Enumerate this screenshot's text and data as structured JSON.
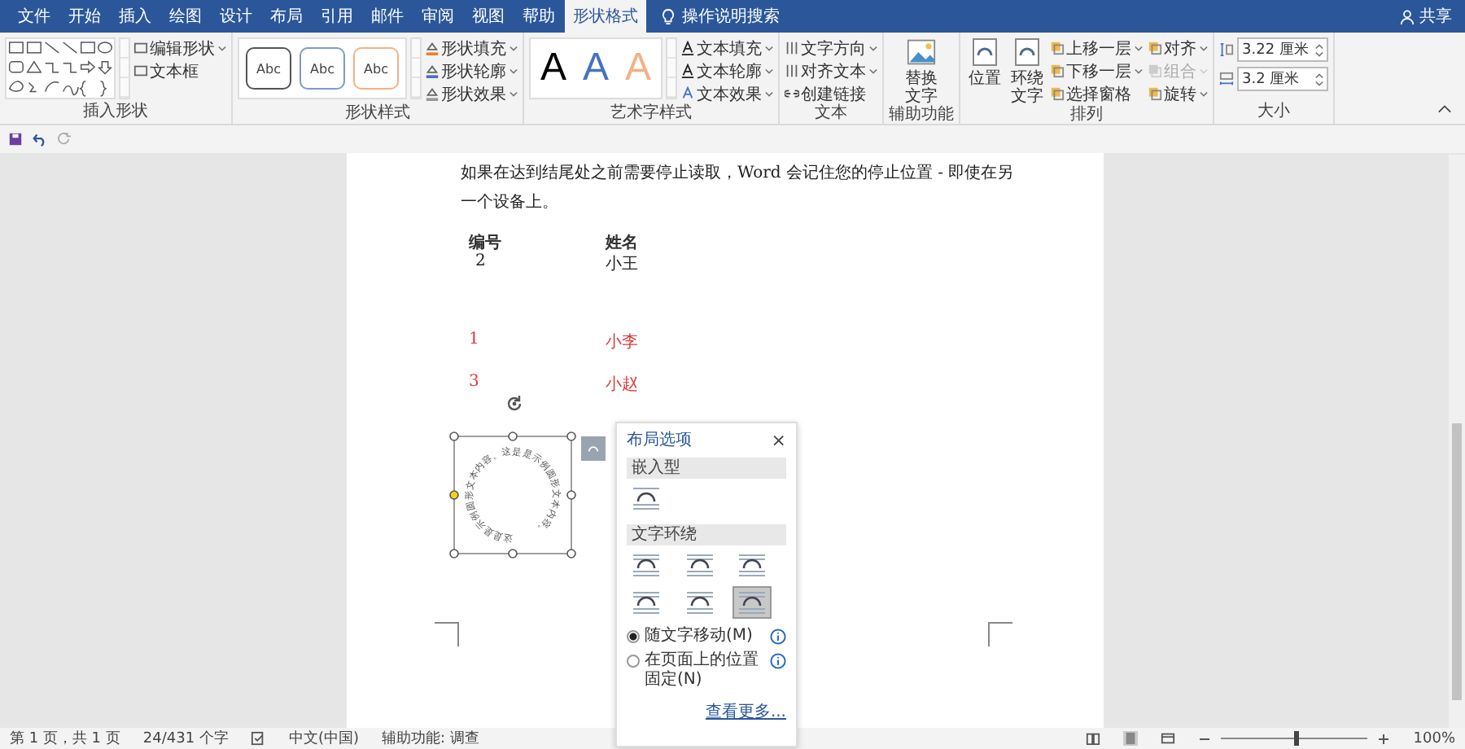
{
  "tabs": [
    {
      "label": "文件",
      "selected": false
    },
    {
      "label": "开始",
      "selected": false
    },
    {
      "label": "插入",
      "selected": false
    },
    {
      "label": "绘图",
      "selected": false
    },
    {
      "label": "设计",
      "selected": false
    },
    {
      "label": "布局",
      "selected": false
    },
    {
      "label": "引用",
      "selected": false
    },
    {
      "label": "邮件",
      "selected": false
    },
    {
      "label": "审阅",
      "selected": false
    },
    {
      "label": "视图",
      "selected": false
    },
    {
      "label": "帮助",
      "selected": false
    },
    {
      "label": "形状格式",
      "selected": true
    }
  ],
  "tell_me": "操作说明搜索",
  "share": "共享",
  "ribbon": {
    "insert_shapes": {
      "label": "插入形状",
      "commands": [
        "编辑形状",
        "文本框"
      ]
    },
    "shape_styles": {
      "label": "形状样式",
      "presets": [
        "Abc",
        "Abc",
        "Abc"
      ],
      "commands": [
        "形状填充",
        "形状轮廓",
        "形状效果"
      ]
    },
    "wordart_styles": {
      "label": "艺术字样式",
      "presets": [
        "A",
        "A",
        "A"
      ],
      "commands": [
        "文本填充",
        "文本轮廓",
        "文本效果"
      ]
    },
    "text": {
      "label": "文本",
      "commands": [
        "文字方向",
        "对齐文本",
        "创建链接"
      ]
    },
    "accessibility": {
      "label": "辅助功能",
      "button": "替换文字"
    },
    "arrange": {
      "label": "排列",
      "big_buttons": [
        "位置",
        "环绕文字"
      ],
      "commands": [
        {
          "label": "上移一层",
          "disabled": false
        },
        {
          "label": "下移一层",
          "disabled": false
        },
        {
          "label": "选择窗格",
          "disabled": false
        },
        {
          "label": "对齐",
          "disabled": false
        },
        {
          "label": "组合",
          "disabled": true
        },
        {
          "label": "旋转",
          "disabled": false
        }
      ]
    },
    "size": {
      "label": "大小",
      "height": "3.22 厘米",
      "width": "3.2 厘米"
    }
  },
  "document": {
    "paragraph": "如果在达到结尾处之前需要停止读取，Word 会记住您的停止位置 - 即使在另一个设备上。",
    "table": {
      "columns": [
        "编号",
        "姓名"
      ],
      "rows": [
        {
          "cells": [
            "2",
            "小王"
          ],
          "color": "#222222"
        },
        {
          "cells": [
            "1",
            "小李"
          ],
          "color": "#d83b3b"
        },
        {
          "cells": [
            "3",
            "小赵"
          ],
          "color": "#d83b3b"
        }
      ]
    },
    "circle_text": "这是是示例圆形文本内容。这是是示例圆形文本内容。"
  },
  "layout_options": {
    "title": "布局选项",
    "close": "×",
    "inline_heading": "嵌入型",
    "wrap_heading": "文字环绕",
    "inline_option": {
      "selected": false
    },
    "wrap_options": [
      {
        "selected": false
      },
      {
        "selected": false
      },
      {
        "selected": false
      },
      {
        "selected": false
      },
      {
        "selected": false
      },
      {
        "selected": true
      }
    ],
    "radios": [
      {
        "label": "随文字移动(M)",
        "selected": true
      },
      {
        "label": "在页面上的位置固定(N)",
        "selected": false
      }
    ],
    "see_more": "查看更多..."
  },
  "status_bar": {
    "page": "第 1 页，共 1 页",
    "words": "24/431 个字",
    "language": "中文(中国)",
    "accessibility": "辅助功能: 调查",
    "zoom": "100%",
    "zoom_level": {
      "level": 0.5
    }
  }
}
